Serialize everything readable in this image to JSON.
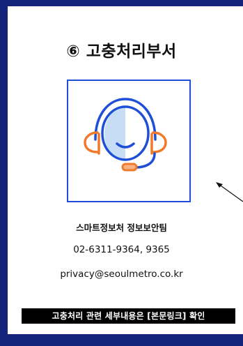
{
  "section": {
    "title": "⑥ 고충처리부서",
    "icon": "headset-support-icon",
    "department": "스마트정보처 정보보안팀",
    "phone": "02-6311-9364, 9365",
    "email": "privacy@seoulmetro.co.kr",
    "notice": "고충처리 관련 세부내용은 [본문링크] 확인"
  },
  "colors": {
    "frame": "#14247a",
    "icon_border": "#1e4fd6",
    "icon_blue": "#1e4fd6",
    "icon_orange": "#f07a2a",
    "icon_light_blue": "#c7dcf5",
    "notice_bg": "#000000"
  }
}
